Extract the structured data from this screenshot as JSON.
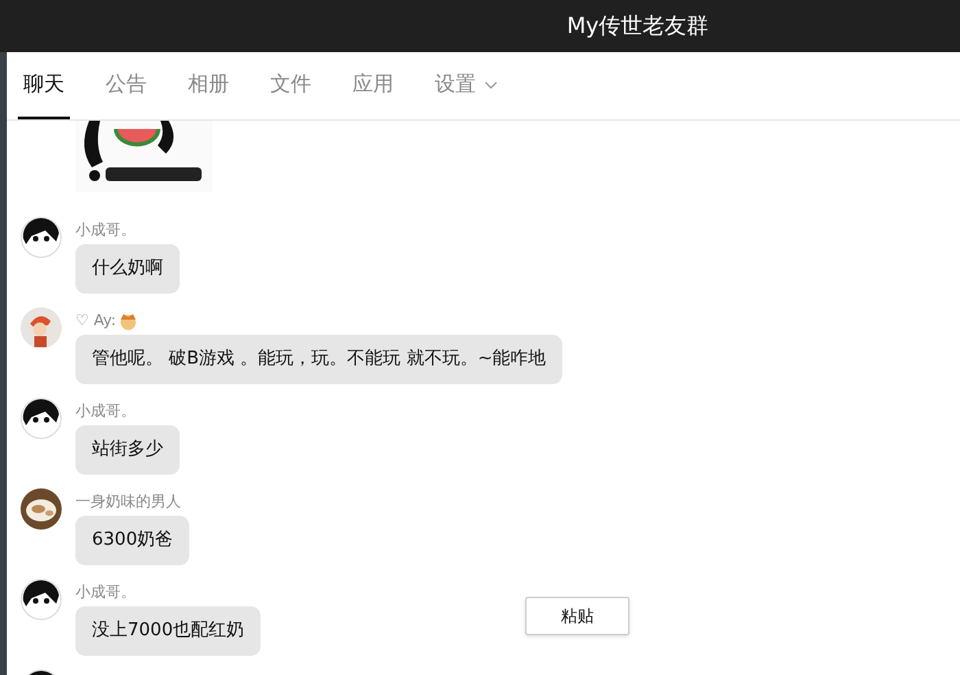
{
  "window": {
    "title": "My传世老友群"
  },
  "tabs": [
    {
      "label": "聊天",
      "selected": true
    },
    {
      "label": "公告",
      "selected": false
    },
    {
      "label": "相册",
      "selected": false
    },
    {
      "label": "文件",
      "selected": false
    },
    {
      "label": "应用",
      "selected": false
    },
    {
      "label": "设置",
      "selected": false,
      "dropdown": true
    }
  ],
  "messages": [
    {
      "avatar": {
        "kind": "dark"
      },
      "sender": "小成哥。",
      "text": "什么奶啊"
    },
    {
      "avatar": {
        "kind": "red"
      },
      "sender": "♡ Ay:",
      "sender_emoji": true,
      "text": "管他呢。 破B游戏 。能玩，玩。不能玩 就不玩。~能咋地"
    },
    {
      "avatar": {
        "kind": "dark"
      },
      "sender": "小成哥。",
      "text": "站街多少"
    },
    {
      "avatar": {
        "kind": "cup"
      },
      "sender": "一身奶味的男人",
      "text": "6300奶爸"
    },
    {
      "avatar": {
        "kind": "dark"
      },
      "sender": "小成哥。",
      "text": "没上7000也配红奶"
    }
  ],
  "trailing_avatar": {
    "kind": "dark"
  },
  "context_menu": {
    "items": [
      "粘贴"
    ]
  }
}
